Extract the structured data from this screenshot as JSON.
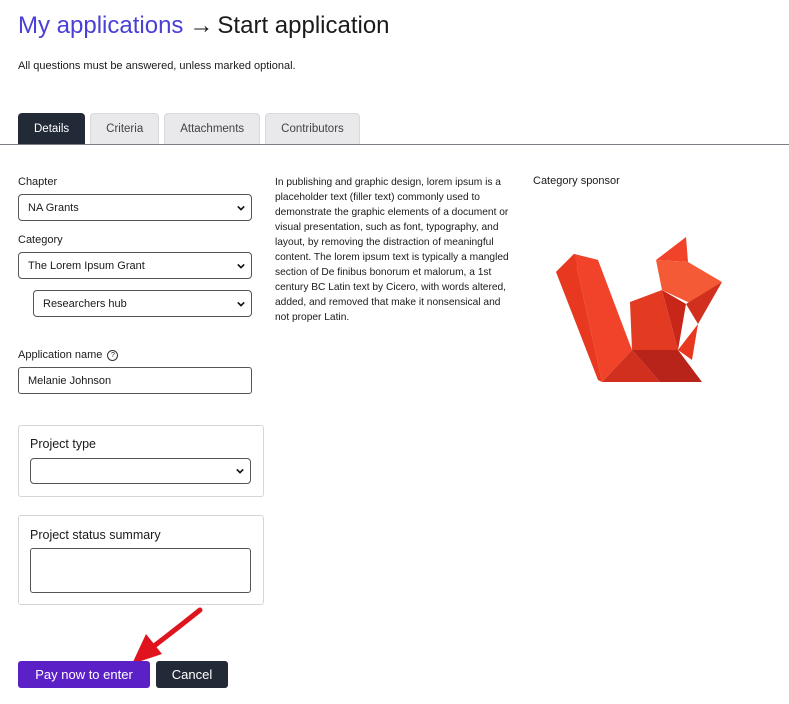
{
  "breadcrumb": {
    "parent": "My applications",
    "separator": "→",
    "current": "Start application"
  },
  "note": "All questions must be answered, unless marked optional.",
  "tabs": [
    {
      "label": "Details",
      "active": true
    },
    {
      "label": "Criteria",
      "active": false
    },
    {
      "label": "Attachments",
      "active": false
    },
    {
      "label": "Contributors",
      "active": false
    }
  ],
  "form": {
    "chapter": {
      "label": "Chapter",
      "value": "NA Grants"
    },
    "category": {
      "label": "Category",
      "value": "The Lorem Ipsum Grant"
    },
    "subcategory": {
      "value": "Researchers hub"
    },
    "application_name": {
      "label": "Application name",
      "value": "Melanie Johnson",
      "help_icon": "question-circle-icon"
    },
    "project_type": {
      "label": "Project type",
      "value": ""
    },
    "project_status": {
      "label": "Project status summary",
      "value": ""
    }
  },
  "description": "In publishing and graphic design, lorem ipsum is a placeholder text (filler text) commonly used to demonstrate the graphic elements of a document or visual presentation, such as font, typography, and layout, by removing the distraction of meaningful content. The lorem ipsum text is typically a mangled section of De finibus bonorum et malorum, a 1st century BC Latin text by Cicero, with words altered, added, and removed that make it nonsensical and not proper Latin.",
  "sponsor": {
    "label": "Category sponsor",
    "logo_icon": "origami-squirrel-logo"
  },
  "buttons": {
    "pay": "Pay now to enter",
    "cancel": "Cancel"
  },
  "colors": {
    "link": "#4a3fd6",
    "tab_active": "#232a37",
    "pay_button": "#5b21c7",
    "annotation_arrow": "#e0141e",
    "logo": "#f0432a"
  }
}
